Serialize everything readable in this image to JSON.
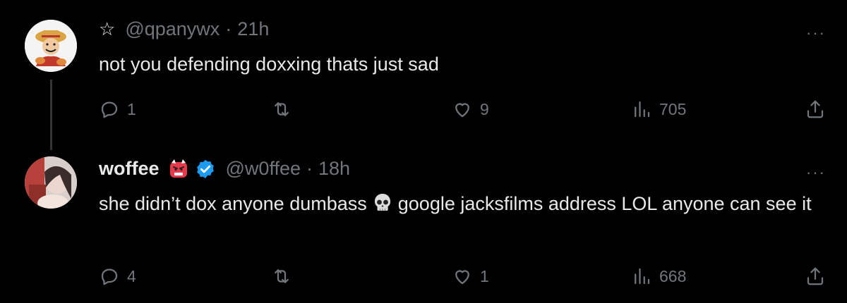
{
  "tweets": [
    {
      "display_name": "",
      "handle": "@qpanywx",
      "separator": "·",
      "time": "21h",
      "text": "not you defending doxxing thats just sad",
      "more": "···",
      "icons": [
        "star-icon"
      ],
      "replies": "1",
      "retweets": "",
      "likes": "9",
      "views": "705"
    },
    {
      "display_name": "woffee",
      "handle": "@w0ffee",
      "separator": "·",
      "time": "18h",
      "text_before": "she didn’t dox anyone dumbass",
      "text_after": "google jacksfilms address LOL anyone can see it",
      "more": "···",
      "icons": [
        "angry-oni-emoji-icon",
        "verified-badge-icon",
        "skull-emoji-icon"
      ],
      "replies": "4",
      "retweets": "",
      "likes": "1",
      "views": "668"
    }
  ],
  "colors": {
    "background": "#000000",
    "text": "#e7e9ea",
    "muted": "#71767b",
    "verified": "#1d9bf0",
    "thread_line": "#333639"
  }
}
